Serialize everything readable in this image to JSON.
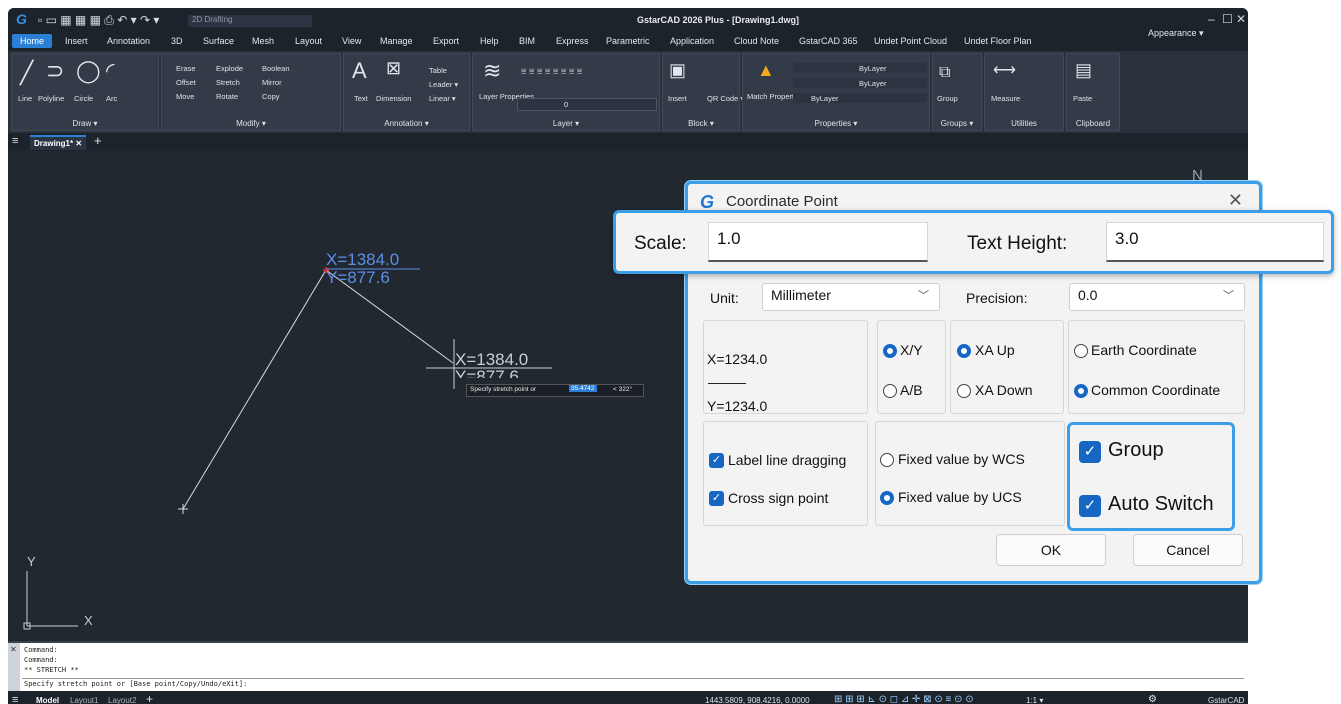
{
  "titlebar": {
    "workspace": "2D Drafting",
    "title": "GstarCAD 2026 Plus - [Drawing1.dwg]",
    "window_controls": [
      "–",
      "☐",
      "✕"
    ]
  },
  "menu": {
    "tabs": [
      "Home",
      "Insert",
      "Annotation",
      "3D",
      "Surface",
      "Mesh",
      "Layout",
      "View",
      "Manage",
      "Export",
      "Help",
      "BIM",
      "Express",
      "Parametric",
      "Application",
      "Cloud Note",
      "GstarCAD 365",
      "Undet Point Cloud",
      "Undet Floor Plan"
    ],
    "appearance": "Appearance ▾"
  },
  "ribbon": {
    "draw": {
      "title": "Draw ▾",
      "tools": [
        "Line",
        "Polyline",
        "Circle",
        "Arc"
      ]
    },
    "modify": {
      "title": "Modify ▾",
      "tools": [
        "Erase",
        "Explode",
        "Boolean",
        "Offset",
        "Stretch",
        "Mirror",
        "Move",
        "Rotate",
        "Copy"
      ]
    },
    "annotation": {
      "title": "Annotation ▾",
      "tools": [
        "Text",
        "Dimension",
        "Table",
        "Leader ▾",
        "Linear ▾"
      ]
    },
    "layer": {
      "title": "Layer ▾",
      "tools": [
        "Layer Properties"
      ],
      "current": "0"
    },
    "block": {
      "title": "Block ▾",
      "tools": [
        "Insert",
        "QR Code ▾"
      ]
    },
    "properties": {
      "title": "Properties ▾",
      "tools": [
        "Match Properties"
      ],
      "color": "ByLayer",
      "linetype": "ByLayer",
      "lineweight": "ByLayer"
    },
    "groups": {
      "title": "Groups ▾",
      "tools": [
        "Group"
      ]
    },
    "utilities": {
      "title": "Utilities",
      "tools": [
        "Measure"
      ]
    },
    "clipboard": {
      "title": "Clipboard",
      "tools": [
        "Paste"
      ]
    }
  },
  "doctab": {
    "name": "Drawing1*"
  },
  "canvas": {
    "coord_x": "X=1384.0",
    "coord_y": "Y=877.6",
    "coord_x2": "X=1384.0",
    "coord_y2": "Y=877.6",
    "tooltip_prompt": "Specify stretch point or",
    "tooltip_value": "35.4742",
    "tooltip_angle": "< 322°",
    "ucs_y": "Y",
    "ucs_x": "X",
    "compass_n": "N"
  },
  "command": {
    "lines": [
      "Command:",
      "Command:",
      "** STRETCH **"
    ],
    "input": "Specify stretch point or [Base point/Copy/Undo/eXit]:"
  },
  "statusbar": {
    "tabs": [
      "Model",
      "Layout1",
      "Layout2"
    ],
    "coords": "1443.5809, 908.4216, 0.0000",
    "scale": "1:1 ▾",
    "brand": "GstarCAD"
  },
  "dialog": {
    "title": "Coordinate Point",
    "scale_label": "Scale:",
    "scale_value": "1.0",
    "text_height_label": "Text Height:",
    "text_height_value": "3.0",
    "unit_label": "Unit:",
    "unit_value": "Millimeter",
    "precision_label": "Precision:",
    "precision_value": "0.0",
    "preview_x": "X=1234.0",
    "preview_y": "Y=1234.0",
    "opt_xy": "X/Y",
    "opt_ab": "A/B",
    "opt_xa_up": "XA Up",
    "opt_xa_down": "XA Down",
    "opt_earth": "Earth Coordinate",
    "opt_common": "Common Coordinate",
    "chk_label_drag": "Label line dragging",
    "chk_cross": "Cross sign point",
    "opt_wcs": "Fixed value by WCS",
    "opt_ucs": "Fixed value by UCS",
    "chk_group": "Group",
    "chk_auto": "Auto Switch",
    "ok": "OK",
    "cancel": "Cancel"
  },
  "colors": {
    "accent": "#3b9ee6",
    "radio": "#1667c4",
    "canvas": "#212830",
    "marker": "#e02020"
  }
}
